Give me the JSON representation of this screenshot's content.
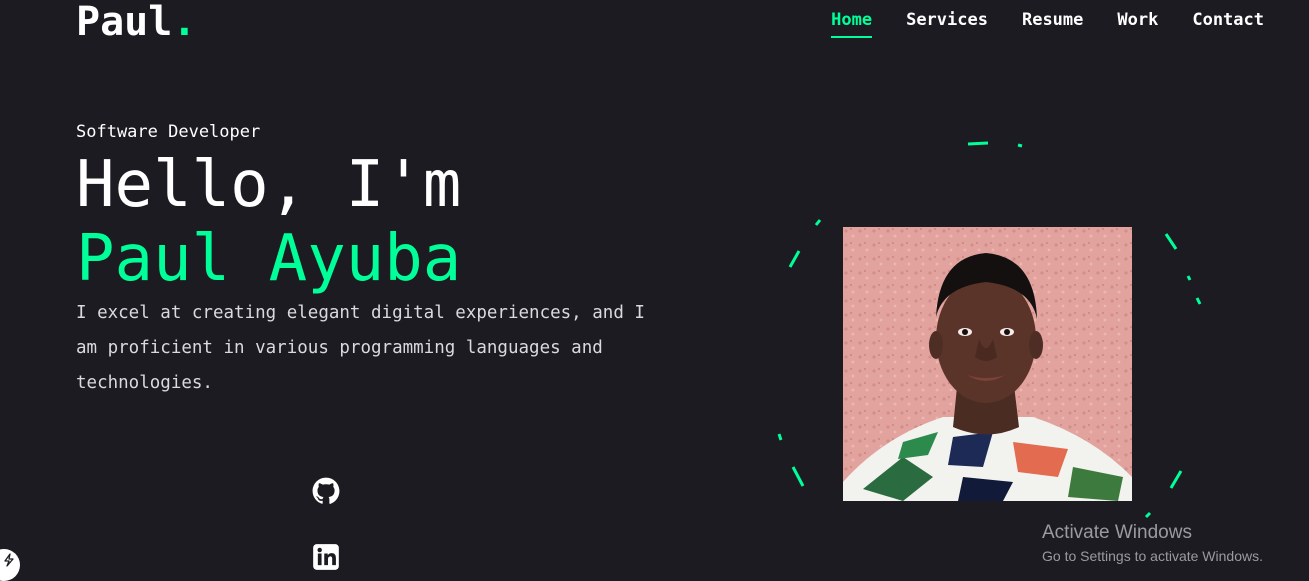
{
  "header": {
    "logo_text": "Paul",
    "logo_dot": ".",
    "nav": [
      {
        "label": "Home",
        "active": true
      },
      {
        "label": "Services",
        "active": false
      },
      {
        "label": "Resume",
        "active": false
      },
      {
        "label": "Work",
        "active": false
      },
      {
        "label": "Contact",
        "active": false
      }
    ]
  },
  "hero": {
    "role": "Software Developer",
    "greeting": "Hello, I'm",
    "name": "Paul Ayuba",
    "description": "I excel at creating elegant digital experiences, and I am proficient in various programming languages and technologies."
  },
  "social": [
    {
      "icon": "github-icon"
    },
    {
      "icon": "linkedin-icon"
    }
  ],
  "windows_notice": {
    "title": "Activate Windows",
    "subtitle": "Go to Settings to activate Windows."
  },
  "colors": {
    "background": "#1c1b22",
    "accent": "#00ff99",
    "text": "#ffffff"
  }
}
